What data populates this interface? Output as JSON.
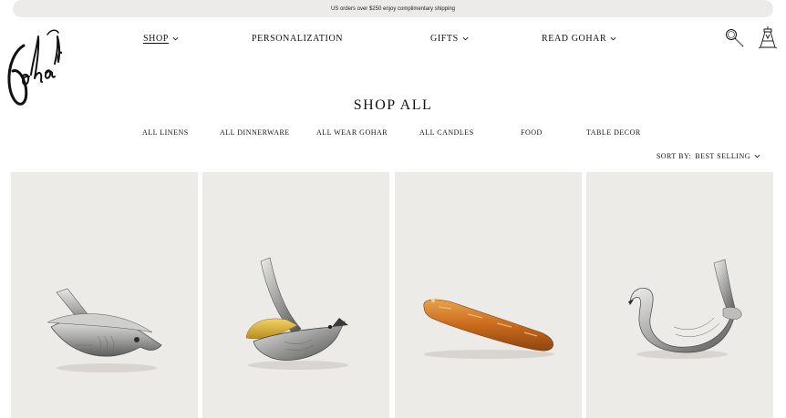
{
  "announcement": "US orders over $250 enjoy complimentary shipping",
  "brand": {
    "logo_text": "Gohar"
  },
  "nav": {
    "items": [
      {
        "label": "SHOP",
        "has_dropdown": true,
        "active": true
      },
      {
        "label": "PERSONALIZATION",
        "has_dropdown": false
      },
      {
        "label": "GIFTS",
        "has_dropdown": true
      },
      {
        "label": "READ GOHAR",
        "has_dropdown": true
      }
    ],
    "icons": [
      "search-icon",
      "cart-icon"
    ]
  },
  "page_title": "SHOP ALL",
  "categories": [
    "ALL LINENS",
    "ALL DINNERWARE",
    "ALL WEAR GOHAR",
    "ALL CANDLES",
    "FOOD",
    "TABLE DECOR"
  ],
  "sort": {
    "label": "SORT BY:",
    "value": "BEST SELLING"
  },
  "products": [
    {
      "image": "fish-lemon-squeezer"
    },
    {
      "image": "bird-lemon-squeezer"
    },
    {
      "image": "baguette"
    },
    {
      "image": "swan-lemon-squeezer"
    }
  ],
  "colors": {
    "announcement_bg": "#ecebe9",
    "card_bg": "#edebe8",
    "text": "#111111"
  }
}
